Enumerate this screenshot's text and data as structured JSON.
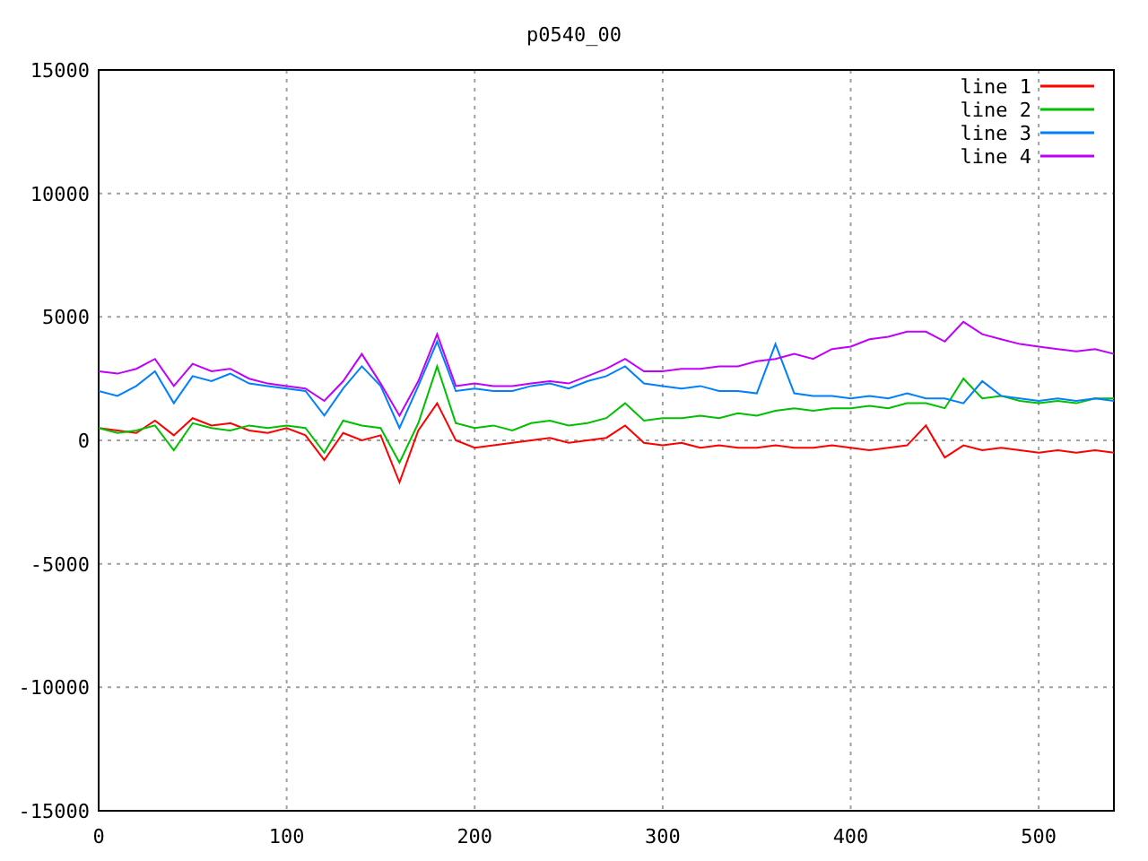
{
  "chart_data": {
    "type": "line",
    "title": "p0540_00",
    "grid": true,
    "legend": true,
    "x": [
      0,
      10,
      20,
      30,
      40,
      50,
      60,
      70,
      80,
      90,
      100,
      110,
      120,
      130,
      140,
      150,
      160,
      170,
      180,
      190,
      200,
      210,
      220,
      230,
      240,
      250,
      260,
      270,
      280,
      290,
      300,
      310,
      320,
      330,
      340,
      350,
      360,
      370,
      380,
      390,
      400,
      410,
      420,
      430,
      440,
      450,
      460,
      470,
      480,
      490,
      500,
      510,
      520,
      530,
      540
    ],
    "xlim": [
      0,
      540
    ],
    "ylim": [
      -15000,
      15000
    ],
    "xticks": [
      0,
      100,
      200,
      300,
      400,
      500
    ],
    "yticks": [
      -15000,
      -10000,
      -5000,
      0,
      5000,
      10000,
      15000
    ],
    "series": [
      {
        "name": "line 1",
        "color": "#ff0000",
        "values": [
          500,
          400,
          300,
          800,
          200,
          900,
          600,
          700,
          400,
          300,
          500,
          200,
          -800,
          300,
          0,
          200,
          -1700,
          400,
          1500,
          0,
          -300,
          -200,
          -100,
          0,
          100,
          -100,
          0,
          100,
          600,
          -100,
          -200,
          -100,
          -300,
          -200,
          -300,
          -300,
          -200,
          -300,
          -300,
          -200,
          -300,
          -400,
          -300,
          -200,
          600,
          -700,
          -200,
          -400,
          -300,
          -400,
          -500,
          -400,
          -500,
          -400,
          -500
        ]
      },
      {
        "name": "line 2",
        "color": "#00c000",
        "values": [
          500,
          300,
          400,
          600,
          -400,
          700,
          500,
          400,
          600,
          500,
          600,
          500,
          -500,
          800,
          600,
          500,
          -900,
          700,
          3000,
          700,
          500,
          600,
          400,
          700,
          800,
          600,
          700,
          900,
          1500,
          800,
          900,
          900,
          1000,
          900,
          1100,
          1000,
          1200,
          1300,
          1200,
          1300,
          1300,
          1400,
          1300,
          1500,
          1500,
          1300,
          2500,
          1700,
          1800,
          1600,
          1500,
          1600,
          1500,
          1700,
          1700
        ]
      },
      {
        "name": "line 3",
        "color": "#0080ff",
        "values": [
          2000,
          1800,
          2200,
          2800,
          1500,
          2600,
          2400,
          2700,
          2300,
          2200,
          2100,
          2000,
          1000,
          2100,
          3000,
          2200,
          500,
          2200,
          4000,
          2000,
          2100,
          2000,
          2000,
          2200,
          2300,
          2100,
          2400,
          2600,
          3000,
          2300,
          2200,
          2100,
          2200,
          2000,
          2000,
          1900,
          3900,
          1900,
          1800,
          1800,
          1700,
          1800,
          1700,
          1900,
          1700,
          1700,
          1500,
          2400,
          1800,
          1700,
          1600,
          1700,
          1600,
          1700,
          1600
        ]
      },
      {
        "name": "line 4",
        "color": "#c000ff",
        "values": [
          2800,
          2700,
          2900,
          3300,
          2200,
          3100,
          2800,
          2900,
          2500,
          2300,
          2200,
          2100,
          1600,
          2400,
          3500,
          2300,
          1000,
          2400,
          4300,
          2200,
          2300,
          2200,
          2200,
          2300,
          2400,
          2300,
          2600,
          2900,
          3300,
          2800,
          2800,
          2900,
          2900,
          3000,
          3000,
          3200,
          3300,
          3500,
          3300,
          3700,
          3800,
          4100,
          4200,
          4400,
          4400,
          4000,
          4800,
          4300,
          4100,
          3900,
          3800,
          3700,
          3600,
          3700,
          3500
        ]
      }
    ]
  }
}
